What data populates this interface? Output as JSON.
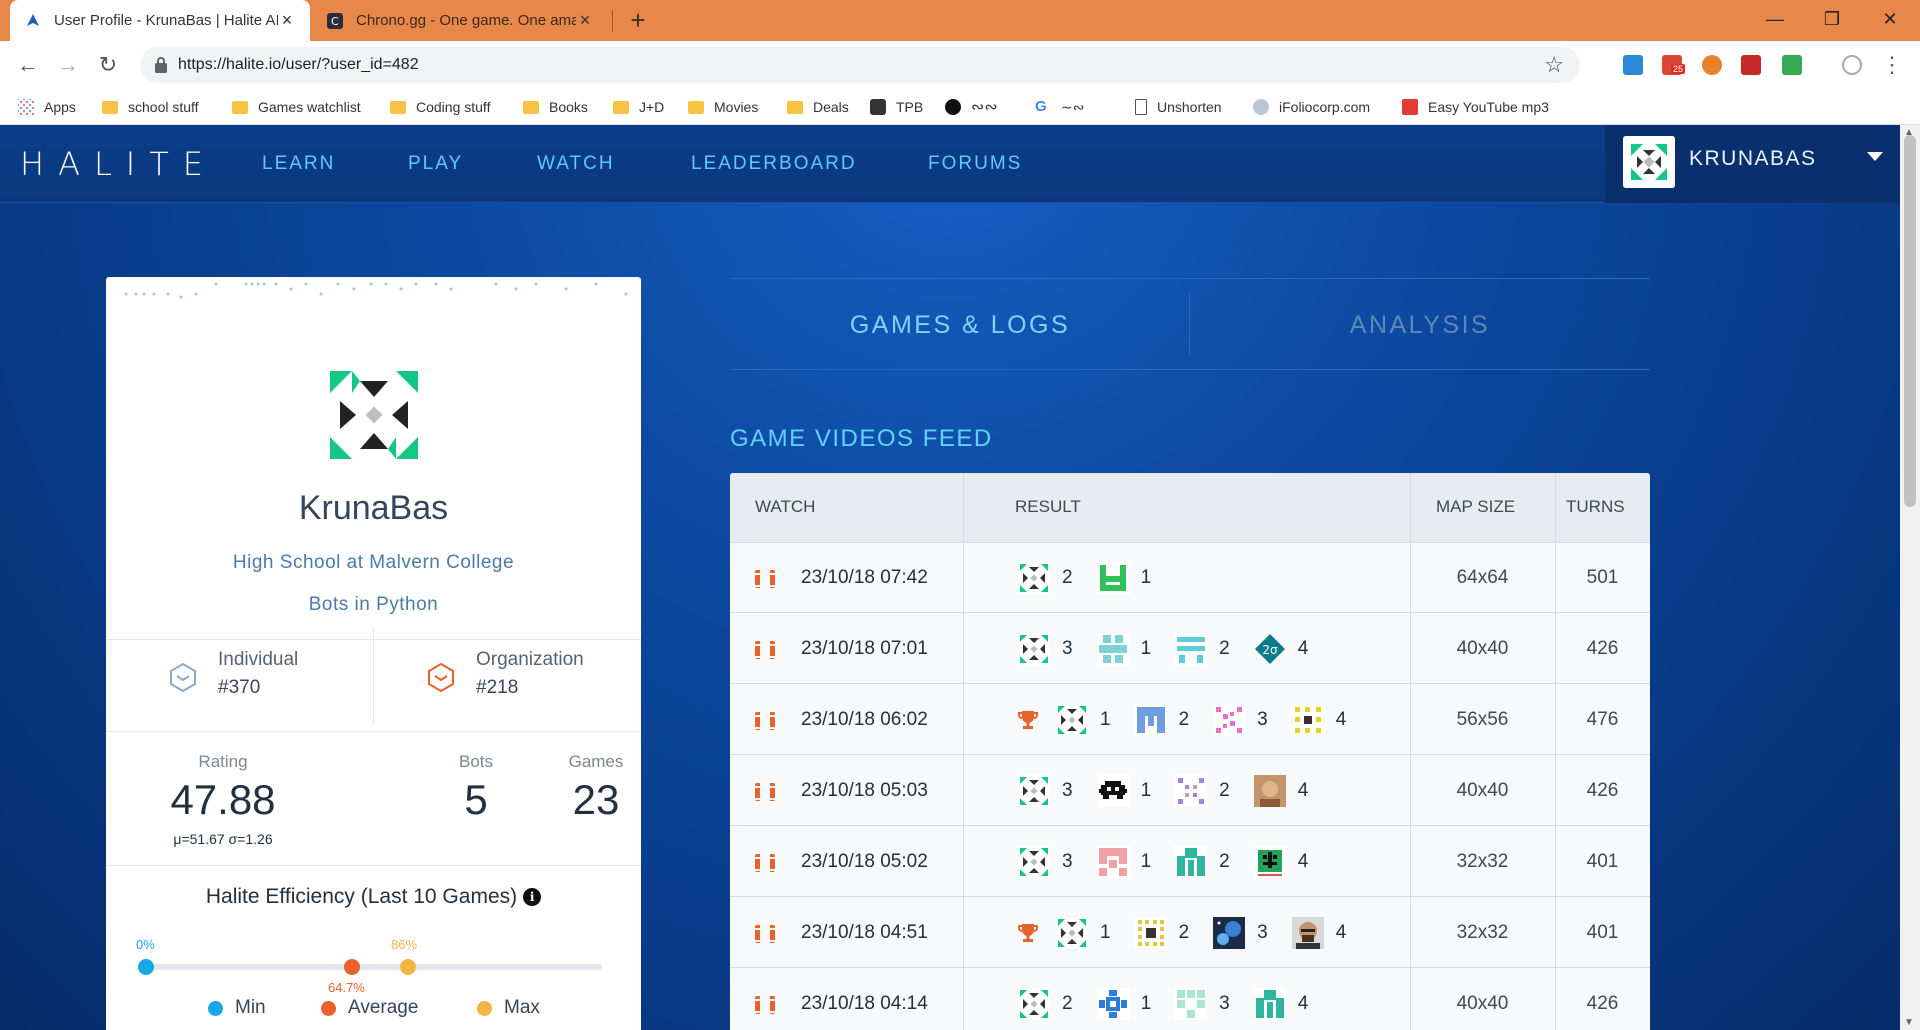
{
  "browser": {
    "tabs": [
      {
        "title": "User Profile - KrunaBas | Halite AI Programming Challenge",
        "active": true
      },
      {
        "title": "Chrono.gg - One game. One amazing deal.",
        "active": false
      }
    ],
    "url": "https://halite.io/user/?user_id=482",
    "bookmarks": [
      "Apps",
      "school stuff",
      "Games watchlist",
      "Coding stuff",
      "Books",
      "J+D",
      "Movies",
      "Deals",
      "TPB",
      "",
      "Unshorten",
      "iFoliocorp.com",
      "Easy YouTube mp3"
    ],
    "extension_badge": "25"
  },
  "site": {
    "logo": "HALITE",
    "nav": [
      "LEARN",
      "PLAY",
      "WATCH",
      "LEADERBOARD",
      "FORUMS"
    ],
    "user": "KRUNABAS"
  },
  "profile": {
    "username": "KrunaBas",
    "school": "High School at Malvern College",
    "language": "Bots in Python",
    "individual_label": "Individual",
    "individual_rank": "#370",
    "organization_label": "Organization",
    "organization_rank": "#218",
    "rating_label": "Rating",
    "rating": "47.88",
    "mu_sigma": "μ=51.67 σ=1.26",
    "bots_label": "Bots",
    "bots": "5",
    "games_label": "Games",
    "games": "23",
    "efficiency_title": "Halite Efficiency (Last 10 Games)",
    "efficiency": {
      "min": "0%",
      "average": "64.7%",
      "max": "86%"
    },
    "legend": [
      "Min",
      "Average",
      "Max"
    ]
  },
  "tabs": [
    "GAMES & LOGS",
    "ANALYSIS"
  ],
  "feed": {
    "title": "GAME VIDEOS FEED",
    "headers": [
      "WATCH",
      "RESULT",
      "MAP SIZE",
      "TURNS"
    ],
    "rows": [
      {
        "date": "23/10/18 07:42",
        "trophy": false,
        "players": [
          {
            "avatar": "krunabas",
            "rank": "2"
          },
          {
            "avatar": "green-h",
            "rank": "1"
          }
        ],
        "map": "64x64",
        "turns": "501"
      },
      {
        "date": "23/10/18 07:01",
        "trophy": false,
        "players": [
          {
            "avatar": "krunabas",
            "rank": "3"
          },
          {
            "avatar": "cyan-blocks",
            "rank": "1"
          },
          {
            "avatar": "teal-bars",
            "rank": "2"
          },
          {
            "avatar": "teal-diamond",
            "rank": "4"
          }
        ],
        "map": "40x40",
        "turns": "426"
      },
      {
        "date": "23/10/18 06:02",
        "trophy": true,
        "players": [
          {
            "avatar": "krunabas",
            "rank": "1"
          },
          {
            "avatar": "blue-arch",
            "rank": "2"
          },
          {
            "avatar": "pink-dots",
            "rank": "3"
          },
          {
            "avatar": "yellow-dots",
            "rank": "4"
          }
        ],
        "map": "56x56",
        "turns": "476"
      },
      {
        "date": "23/10/18 05:03",
        "trophy": false,
        "players": [
          {
            "avatar": "krunabas",
            "rank": "3"
          },
          {
            "avatar": "space-invader",
            "rank": "1"
          },
          {
            "avatar": "purple-dots",
            "rank": "2"
          },
          {
            "avatar": "photo-face",
            "rank": "4"
          }
        ],
        "map": "40x40",
        "turns": "426"
      },
      {
        "date": "23/10/18 05:02",
        "trophy": false,
        "players": [
          {
            "avatar": "krunabas",
            "rank": "3"
          },
          {
            "avatar": "pink-blocks",
            "rank": "1"
          },
          {
            "avatar": "teal-arch",
            "rank": "2"
          },
          {
            "avatar": "green-bug",
            "rank": "4"
          }
        ],
        "map": "32x32",
        "turns": "401"
      },
      {
        "date": "23/10/18 04:51",
        "trophy": true,
        "players": [
          {
            "avatar": "krunabas",
            "rank": "1"
          },
          {
            "avatar": "yellow-ring",
            "rank": "2"
          },
          {
            "avatar": "space-photo",
            "rank": "3"
          },
          {
            "avatar": "photo-man",
            "rank": "4"
          }
        ],
        "map": "32x32",
        "turns": "401"
      },
      {
        "date": "23/10/18 04:14",
        "trophy": false,
        "players": [
          {
            "avatar": "krunabas",
            "rank": "2"
          },
          {
            "avatar": "blue-cross",
            "rank": "1"
          },
          {
            "avatar": "mint-blocks",
            "rank": "3"
          },
          {
            "avatar": "teal-arch",
            "rank": "4"
          }
        ],
        "map": "40x40",
        "turns": "426"
      }
    ]
  },
  "colors": {
    "accent": "#62d2f7",
    "film": "#e9622d",
    "min": "#1aa7e8",
    "average": "#e9622d",
    "max": "#f2b443"
  }
}
